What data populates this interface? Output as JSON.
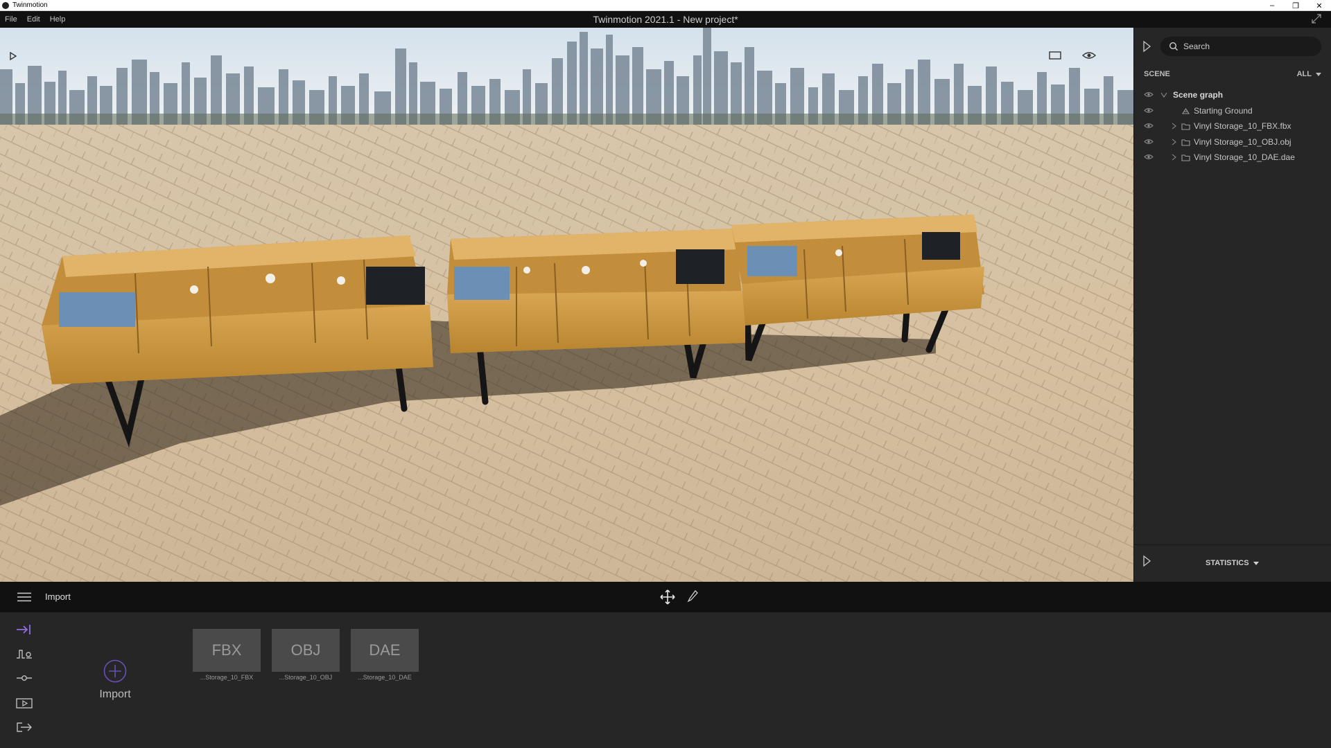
{
  "os": {
    "title": "Twinmotion",
    "minimize": "–",
    "maximize": "❐",
    "close": "✕"
  },
  "menu": {
    "items": [
      "File",
      "Edit",
      "Help"
    ],
    "document_title": "Twinmotion 2021.1 - New project*"
  },
  "scene_panel": {
    "search_placeholder": "Search",
    "section_label": "SCENE",
    "filter_label": "ALL",
    "tree": {
      "root": "Scene graph",
      "items": [
        "Starting Ground",
        "Vinyl Storage_10_FBX.fbx",
        "Vinyl Storage_10_OBJ.obj",
        "Vinyl Storage_10_DAE.dae"
      ]
    },
    "statistics_label": "STATISTICS"
  },
  "bottom_toolbar": {
    "title": "Import"
  },
  "import_panel": {
    "import_label": "Import",
    "files": [
      {
        "type": "FBX",
        "caption": "...Storage_10_FBX"
      },
      {
        "type": "OBJ",
        "caption": "...Storage_10_OBJ"
      },
      {
        "type": "DAE",
        "caption": "...Storage_10_DAE"
      }
    ]
  },
  "colors": {
    "accent": "#8e6fe0",
    "panel_bg": "#262626",
    "bar_bg": "#111111",
    "sky": "#dfe7ee",
    "pavement": "#d8c3a4",
    "wood": "#c9953f"
  }
}
